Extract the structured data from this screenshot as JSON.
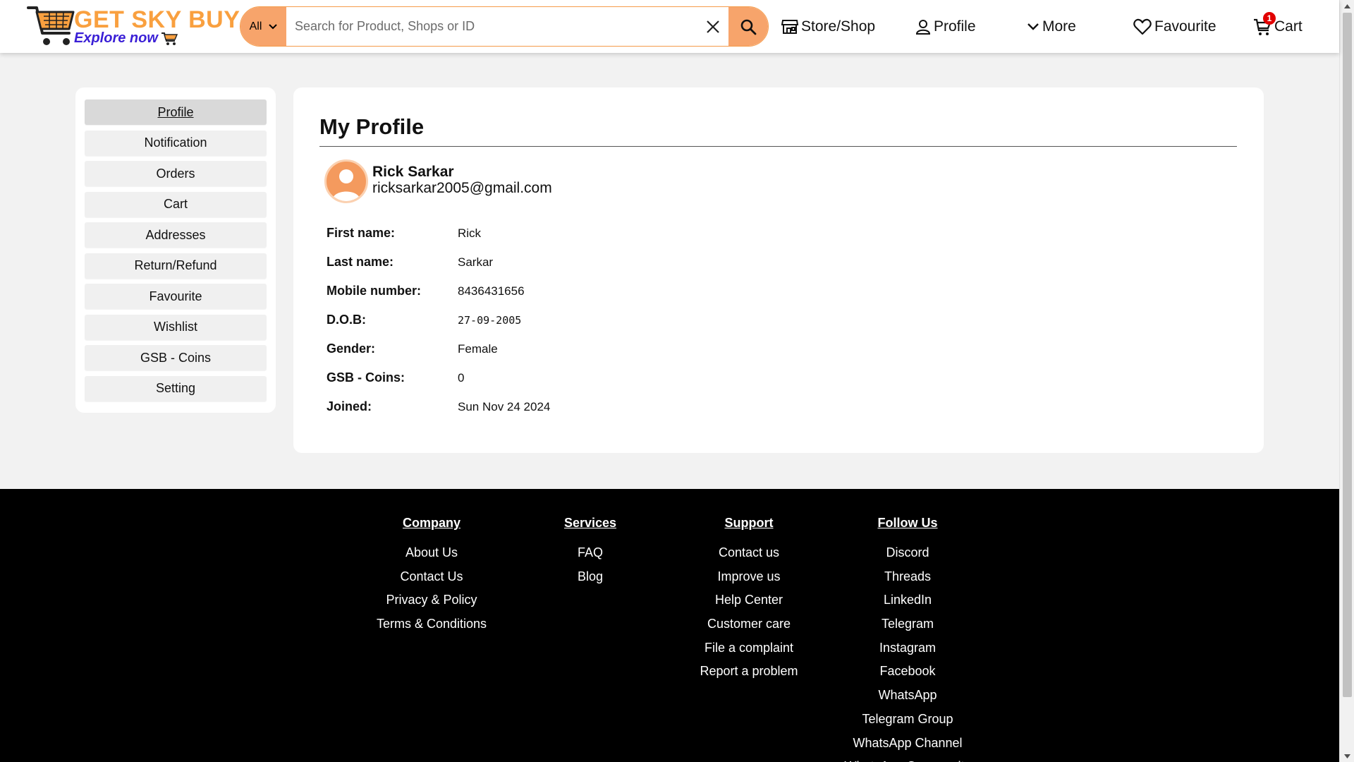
{
  "header": {
    "logo_title": "GET SKY BUY",
    "logo_subtitle": "Explore now",
    "search_category": "All",
    "search_placeholder": "Search for Product, Shops or ID",
    "nav": {
      "store": "Store/Shop",
      "profile": "Profile",
      "more": "More",
      "favourite": "Favourite",
      "cart": "Cart",
      "cart_count": "1"
    }
  },
  "sidebar": {
    "items": [
      {
        "label": "Profile"
      },
      {
        "label": "Notification"
      },
      {
        "label": "Orders"
      },
      {
        "label": "Cart"
      },
      {
        "label": "Addresses"
      },
      {
        "label": "Return/Refund"
      },
      {
        "label": "Favourite"
      },
      {
        "label": "Wishlist"
      },
      {
        "label": "GSB - Coins"
      },
      {
        "label": "Setting"
      }
    ]
  },
  "profile": {
    "title": "My Profile",
    "name": "Rick Sarkar",
    "email": "ricksarkar2005@gmail.com",
    "fields": [
      {
        "label": "First name:",
        "value": "Rick"
      },
      {
        "label": "Last name:",
        "value": "Sarkar"
      },
      {
        "label": "Mobile number:",
        "value": "8436431656"
      },
      {
        "label": "D.O.B:",
        "value": "27-09-2005"
      },
      {
        "label": "Gender:",
        "value": "Female"
      },
      {
        "label": "GSB - Coins:",
        "value": "0"
      },
      {
        "label": "Joined:",
        "value": "Sun Nov 24 2024"
      }
    ]
  },
  "footer": {
    "company": {
      "title": "Company",
      "links": [
        "About Us",
        "Contact Us",
        "Privacy & Policy",
        "Terms & Conditions"
      ]
    },
    "services": {
      "title": "Services",
      "links": [
        "FAQ",
        "Blog"
      ]
    },
    "support": {
      "title": "Support",
      "links": [
        "Contact us",
        "Improve us",
        "Help Center",
        "Customer care",
        "File a complaint",
        "Report a problem"
      ]
    },
    "follow": {
      "title": "Follow Us",
      "links": [
        "Discord",
        "Threads",
        "LinkedIn",
        "Telegram",
        "Instagram",
        "Facebook",
        "WhatsApp",
        "Telegram Group",
        "WhatsApp Channel",
        "WhatsApp Community"
      ]
    }
  },
  "colors": {
    "accent": "#f7a46b",
    "brand_orange": "#f9a03f",
    "brand_blue": "#3a1fd6",
    "footer_bg": "#000000",
    "badge": "#e10000"
  }
}
